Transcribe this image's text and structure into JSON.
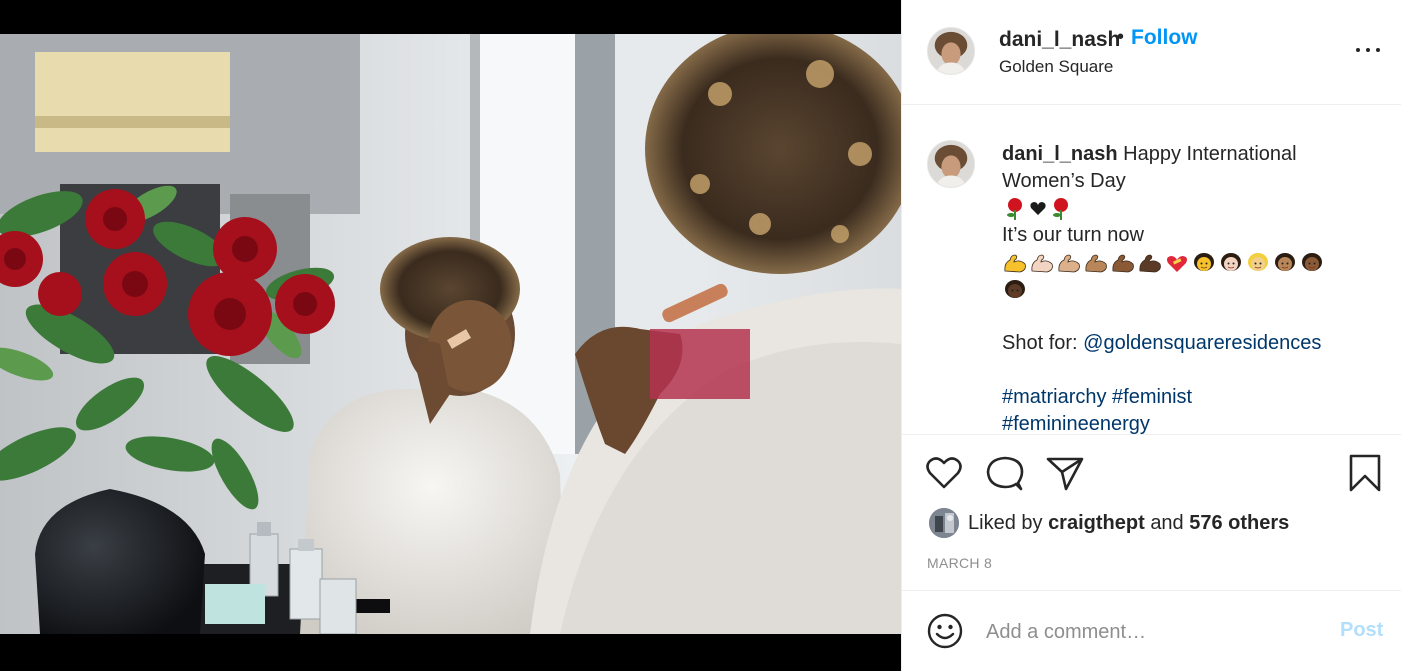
{
  "post": {
    "username": "dani_l_nash",
    "separator": "•",
    "follow_label": "Follow",
    "location": "Golden Square"
  },
  "caption": {
    "username": "dani_l_nash",
    "text_line1": "Happy International",
    "text_line2": "Women’s Day",
    "line_turn": "It’s our turn now",
    "shot_for_label": "Shot for:",
    "shot_for_handle": "@goldensquareresidences",
    "hashtag1": "#matriarchy",
    "hashtag2": "#feminist",
    "hashtag3": "#feminineenergy",
    "emoji_row1": [
      "rose-emoji",
      "black-heart-emoji",
      "rose-emoji"
    ],
    "emoji_row2": [
      "flexed-biceps-emoji",
      "flexed-biceps-light-emoji",
      "flexed-biceps-medium-light-emoji",
      "flexed-biceps-medium-emoji",
      "flexed-biceps-medium-dark-emoji",
      "flexed-biceps-dark-emoji",
      "heart-ribbon-emoji",
      "person-emoji",
      "person-light-emoji",
      "person-blond-emoji",
      "person-medium-emoji",
      "person-medium-dark-emoji"
    ],
    "emoji_row3": [
      "person-dark-emoji"
    ]
  },
  "actions": {
    "icons": [
      "heart-icon",
      "comment-icon",
      "share-icon",
      "bookmark-icon"
    ],
    "liked_by_label": "Liked by",
    "liked_by_user": "craigthept",
    "and_label": "and",
    "others_label": "576 others",
    "date": "MARCH 8"
  },
  "comment": {
    "placeholder": "Add a comment…",
    "post_label": "Post"
  },
  "colors": {
    "accent": "#0095f6",
    "link": "#00376b",
    "muted": "#8e8e8e",
    "post_disabled": "#b2dffc",
    "border": "#efefef"
  }
}
